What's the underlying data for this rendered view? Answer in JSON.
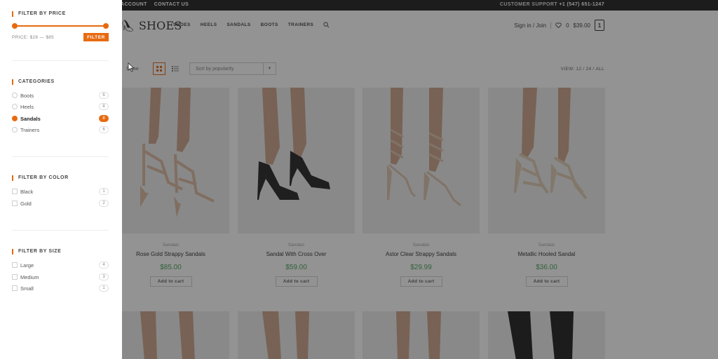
{
  "topbar": {
    "links": [
      "ACCOUNT",
      "CONTACT US"
    ],
    "support_label": "CUSTOMER SUPPORT",
    "support_phone": "+1 (547) 651-1247"
  },
  "header": {
    "logo": "SHOES",
    "nav": [
      "SHOES",
      "HEELS",
      "SANDALS",
      "BOOTS",
      "TRAINERS"
    ],
    "signin": "Sign in / Join",
    "wishlist_count": "0",
    "cart_total": "$39.00",
    "cart_count": "1"
  },
  "toolbar": {
    "show_label": "Show",
    "sort_value": "Sort by popularity",
    "view_label": "VIEW:",
    "view_options": [
      "12",
      "24",
      "ALL"
    ]
  },
  "products": [
    {
      "category": "Sandals",
      "name": "Rose Gold Strappy Sandals",
      "price": "$85.00",
      "cta": "Add to cart",
      "shoe_color": "#d8b49a"
    },
    {
      "category": "Sandals",
      "name": "Sandal With Cross Over",
      "price": "$59.00",
      "cta": "Add to cart",
      "shoe_color": "#161616"
    },
    {
      "category": "Sandals",
      "name": "Astor Clear Strappy Sandals",
      "price": "$29.99",
      "cta": "Add to cart",
      "shoe_color": "#d9bea8"
    },
    {
      "category": "Sandals",
      "name": "Metallic Hooled Sandal",
      "price": "$36.00",
      "cta": "Add to cart",
      "shoe_color": "#dac6ad"
    }
  ],
  "drawer": {
    "price": {
      "title": "FILTER BY PRICE",
      "range_label": "PRICE: $28 — $85",
      "button": "FILTER",
      "min_fraction": 0,
      "max_fraction": 1
    },
    "categories": {
      "title": "CATEGORIES",
      "items": [
        {
          "label": "Boots",
          "count": "6",
          "selected": false
        },
        {
          "label": "Heels",
          "count": "8",
          "selected": false
        },
        {
          "label": "Sandals",
          "count": "8",
          "selected": true
        },
        {
          "label": "Trainers",
          "count": "6",
          "selected": false
        }
      ]
    },
    "color": {
      "title": "FILTER BY COLOR",
      "items": [
        {
          "label": "Black",
          "count": "1"
        },
        {
          "label": "Gold",
          "count": "2"
        }
      ]
    },
    "size": {
      "title": "FILTER BY SIZE",
      "items": [
        {
          "label": "Large",
          "count": "4"
        },
        {
          "label": "Medium",
          "count": "3"
        },
        {
          "label": "Small",
          "count": "1"
        }
      ]
    }
  },
  "colors": {
    "accent": "#e86a10",
    "price_green": "#3a9a4a",
    "overlay": "rgba(40,40,40,.5)"
  }
}
